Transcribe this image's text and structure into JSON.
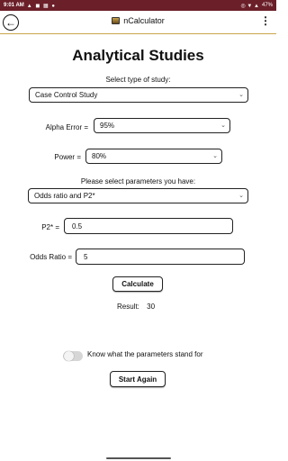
{
  "status": {
    "time": "9:01 AM",
    "left_icons": "▲ ◼ ▦ ●",
    "right_icons": "◎ ▼ ▲",
    "battery": "47%"
  },
  "appbar": {
    "title": "nCalculator",
    "back_glyph": "←",
    "menu_glyph": "⋮"
  },
  "page": {
    "title": "Analytical Studies"
  },
  "study": {
    "label": "Select type of study:",
    "value": "Case Control Study"
  },
  "alpha": {
    "label": "Alpha Error =",
    "value": "95%"
  },
  "power": {
    "label": "Power =",
    "value": "80%"
  },
  "params": {
    "label": "Please select parameters you have:",
    "value": "Odds ratio and P2*"
  },
  "p2": {
    "label": "P2* =",
    "value": "0.5"
  },
  "odds": {
    "label": "Odds Ratio =",
    "value": "5"
  },
  "buttons": {
    "calculate": "Calculate",
    "start_again": "Start Again"
  },
  "result": {
    "label": "Result:",
    "value": "30"
  },
  "toggle": {
    "label": "Know what the parameters stand for",
    "on": false
  },
  "chevron": "⌄"
}
